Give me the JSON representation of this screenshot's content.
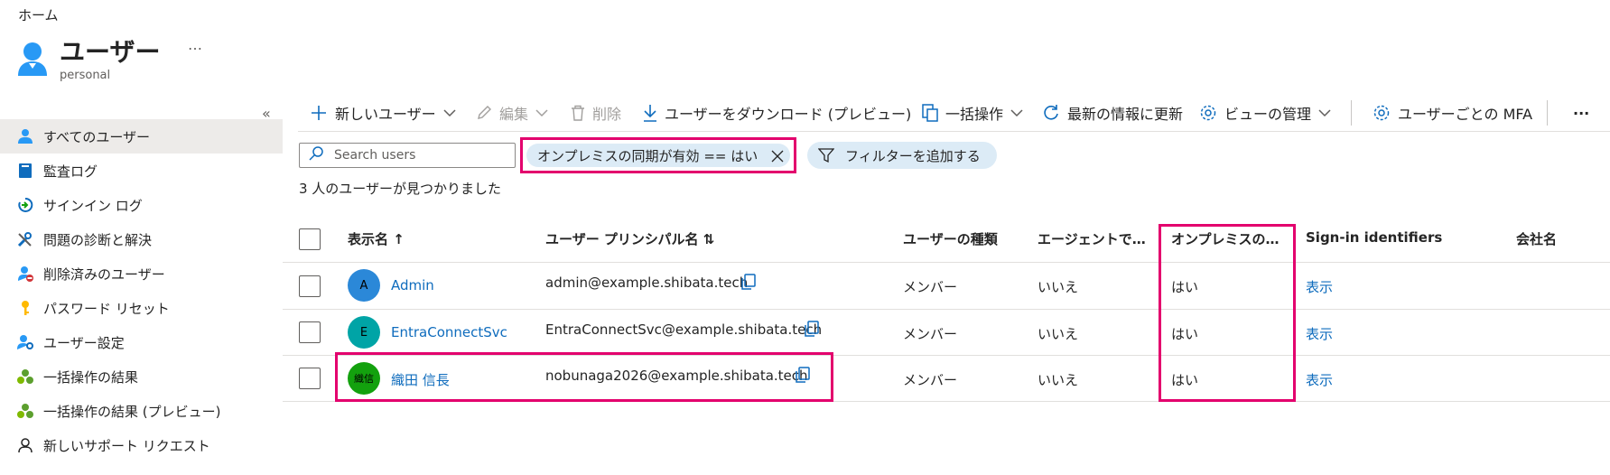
{
  "breadcrumb": "ホーム",
  "header": {
    "title": "ユーザー",
    "subtitle": "personal",
    "more": "…"
  },
  "sidebar": {
    "collapse": "«",
    "items": [
      {
        "label": "すべてのユーザー",
        "icon": "user-icon"
      },
      {
        "label": "監査ログ",
        "icon": "book-icon"
      },
      {
        "label": "サインイン ログ",
        "icon": "sign-in-icon"
      },
      {
        "label": "問題の診断と解決",
        "icon": "wrench-icon"
      },
      {
        "label": "削除済みのユーザー",
        "icon": "deleted-user-icon"
      },
      {
        "label": "パスワード リセット",
        "icon": "key-icon"
      },
      {
        "label": "ユーザー設定",
        "icon": "user-settings-icon"
      },
      {
        "label": "一括操作の結果",
        "icon": "group-icon"
      },
      {
        "label": "一括操作の結果 (プレビュー)",
        "icon": "group-icon"
      },
      {
        "label": "新しいサポート リクエスト",
        "icon": "support-icon"
      }
    ]
  },
  "toolbar": {
    "new_user": "新しいユーザー",
    "edit": "編集",
    "delete": "削除",
    "download": "ユーザーをダウンロード (プレビュー)",
    "bulk": "一括操作",
    "refresh": "最新の情報に更新",
    "manage_view": "ビューの管理",
    "mfa": "ユーザーごとの MFA",
    "more": "···"
  },
  "filters": {
    "search_placeholder": "Search users",
    "active_filter": "オンプレミスの同期が有効 == はい",
    "add_filter": "フィルターを追加する"
  },
  "result_count": "3 人のユーザーが見つかりました",
  "table": {
    "columns": [
      "表示名 ↑",
      "ユーザー プリンシパル名 ⇅",
      "ユーザーの種類",
      "エージェントで…",
      "オンプレミスの…",
      "Sign-in identifiers",
      "会社名"
    ],
    "rows": [
      {
        "initials": "A",
        "avatar_color": "#2b88d8",
        "initials_color": "#000000",
        "name": "Admin",
        "upn": "admin@example.shibata.tech",
        "type": "メンバー",
        "agent": "いいえ",
        "onprem": "はい",
        "signin": "表示"
      },
      {
        "initials": "E",
        "avatar_color": "#00a4a6",
        "initials_color": "#000000",
        "name": "EntraConnectSvc",
        "upn": "EntraConnectSvc@example.shibata.tech",
        "type": "メンバー",
        "agent": "いいえ",
        "onprem": "はい",
        "signin": "表示"
      },
      {
        "initials": "織信",
        "avatar_color": "#13a10e",
        "initials_color": "#000000",
        "name": "織田 信長",
        "upn": "nobunaga2026@example.shibata.tech",
        "type": "メンバー",
        "agent": "いいえ",
        "onprem": "はい",
        "signin": "表示"
      }
    ]
  },
  "colors": {
    "accent": "#0f6cbd",
    "highlight": "#e3006d"
  }
}
